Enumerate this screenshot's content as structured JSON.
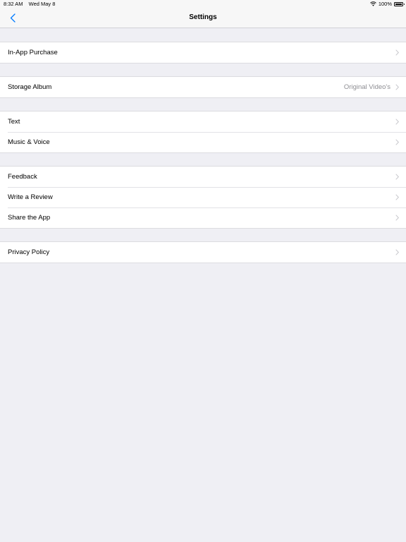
{
  "status_bar": {
    "time": "8:32 AM",
    "date": "Wed May 8",
    "battery": "100%"
  },
  "nav": {
    "title": "Settings",
    "back_icon": "chevron-left-icon"
  },
  "colors": {
    "accent": "#007aff",
    "background": "#efeff4",
    "detail_text": "#8e8e93",
    "chevron": "#c7c7cc"
  },
  "groups": [
    {
      "rows": [
        {
          "label": "In-App Purchase"
        }
      ]
    },
    {
      "rows": [
        {
          "label": "Storage Album",
          "detail": "Original Video's"
        }
      ]
    },
    {
      "rows": [
        {
          "label": "Text"
        },
        {
          "label": "Music & Voice"
        }
      ]
    },
    {
      "rows": [
        {
          "label": "Feedback"
        },
        {
          "label": "Write a Review"
        },
        {
          "label": "Share the App"
        }
      ]
    },
    {
      "rows": [
        {
          "label": "Privacy Policy"
        }
      ]
    }
  ]
}
